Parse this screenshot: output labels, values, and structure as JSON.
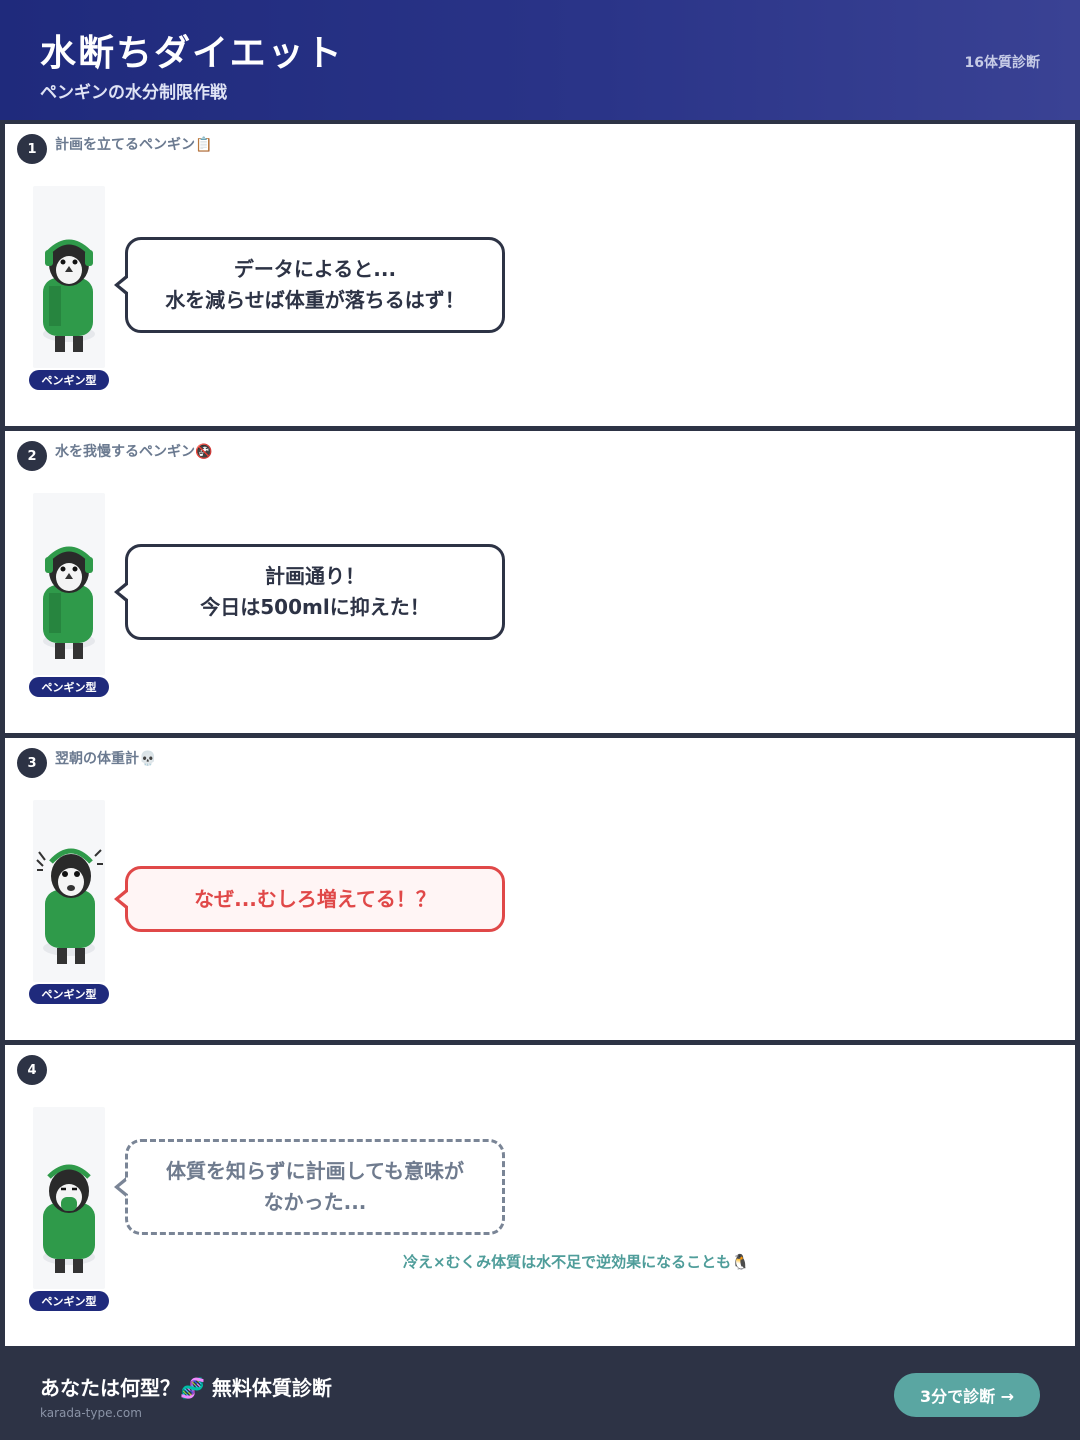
{
  "header": {
    "title": "水断ちダイエット",
    "subtitle": "ペンギンの水分制限作戦",
    "brand": "16体質診断"
  },
  "panels": [
    {
      "number": "1",
      "caption": "計画を立てるペンギン📋",
      "character_tag": "ペンギン型",
      "bubble_style": "normal",
      "bubble_lines": [
        "データによると...",
        "水を減らせば体重が落ちるはず！"
      ]
    },
    {
      "number": "2",
      "caption": "水を我慢するペンギン🚱",
      "character_tag": "ペンギン型",
      "bubble_style": "normal",
      "bubble_lines": [
        "計画通り！",
        "今日は500mlに抑えた！"
      ]
    },
    {
      "number": "3",
      "caption": "翌朝の体重計💀",
      "character_tag": "ペンギン型",
      "bubble_style": "alert",
      "bubble_lines": [
        "なぜ...むしろ増えてる！？"
      ]
    },
    {
      "number": "4",
      "caption": "",
      "character_tag": "ペンギン型",
      "bubble_style": "dashed",
      "bubble_lines": [
        "体質を知らずに計画しても意味が",
        "なかった..."
      ],
      "note": "冷え×むくみ体質は水不足で逆効果になることも🐧"
    }
  ],
  "footer": {
    "cta_title": "あなたは何型？🧬 無料体質診断",
    "domain": "karada-type.com",
    "cta_button": "3分で診断 →"
  },
  "colors": {
    "header_bg": "#1f2a7c",
    "dark": "#2d3345",
    "alert": "#e04848",
    "accent_teal": "#5aa6a2",
    "jacket_green": "#2f9a4a"
  }
}
